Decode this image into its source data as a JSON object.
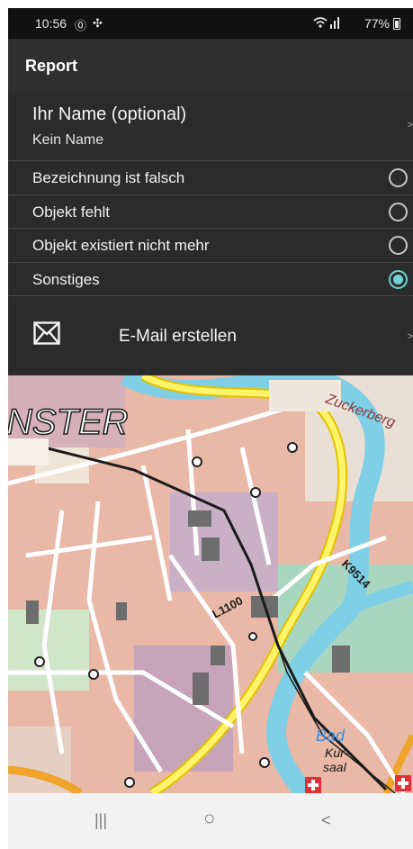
{
  "status_bar": {
    "time": "10:56",
    "battery": "77%",
    "icons": [
      "notification-badge-icon",
      "fan-icon",
      "wifi-icon",
      "signal-icon",
      "battery-icon"
    ]
  },
  "header": {
    "title": "Report"
  },
  "name_field": {
    "label": "Ihr Name (optional)",
    "value": "Kein Name"
  },
  "report_options": [
    {
      "label": "Bezeichnung ist falsch",
      "selected": false
    },
    {
      "label": "Objekt fehlt",
      "selected": false
    },
    {
      "label": "Objekt existiert nicht mehr",
      "selected": false
    },
    {
      "label": "Sonstiges",
      "selected": true
    }
  ],
  "email_action": {
    "label": "E-Mail erstellen",
    "icon": "envelope-icon"
  },
  "map": {
    "labels": [
      "NSTER",
      "Zuckerberg",
      "L1100",
      "K9514",
      "Bad",
      "Kur-",
      "saal"
    ]
  },
  "chevron": ">",
  "colors": {
    "accent": "#6fd3d3",
    "background": "#2b2b2b",
    "header": "#2f2f2f"
  },
  "nav_bar": {
    "recents": "|||",
    "home": "○",
    "back": "<"
  }
}
